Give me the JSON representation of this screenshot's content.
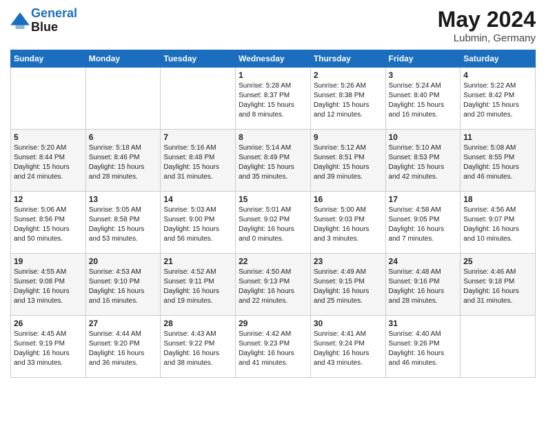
{
  "header": {
    "logo_line1": "General",
    "logo_line2": "Blue",
    "month": "May 2024",
    "location": "Lubmin, Germany"
  },
  "weekdays": [
    "Sunday",
    "Monday",
    "Tuesday",
    "Wednesday",
    "Thursday",
    "Friday",
    "Saturday"
  ],
  "weeks": [
    [
      {
        "day": "",
        "sunrise": "",
        "sunset": "",
        "daylight": ""
      },
      {
        "day": "",
        "sunrise": "",
        "sunset": "",
        "daylight": ""
      },
      {
        "day": "",
        "sunrise": "",
        "sunset": "",
        "daylight": ""
      },
      {
        "day": "1",
        "sunrise": "Sunrise: 5:28 AM",
        "sunset": "Sunset: 8:37 PM",
        "daylight": "Daylight: 15 hours and 8 minutes."
      },
      {
        "day": "2",
        "sunrise": "Sunrise: 5:26 AM",
        "sunset": "Sunset: 8:38 PM",
        "daylight": "Daylight: 15 hours and 12 minutes."
      },
      {
        "day": "3",
        "sunrise": "Sunrise: 5:24 AM",
        "sunset": "Sunset: 8:40 PM",
        "daylight": "Daylight: 15 hours and 16 minutes."
      },
      {
        "day": "4",
        "sunrise": "Sunrise: 5:22 AM",
        "sunset": "Sunset: 8:42 PM",
        "daylight": "Daylight: 15 hours and 20 minutes."
      }
    ],
    [
      {
        "day": "5",
        "sunrise": "Sunrise: 5:20 AM",
        "sunset": "Sunset: 8:44 PM",
        "daylight": "Daylight: 15 hours and 24 minutes."
      },
      {
        "day": "6",
        "sunrise": "Sunrise: 5:18 AM",
        "sunset": "Sunset: 8:46 PM",
        "daylight": "Daylight: 15 hours and 28 minutes."
      },
      {
        "day": "7",
        "sunrise": "Sunrise: 5:16 AM",
        "sunset": "Sunset: 8:48 PM",
        "daylight": "Daylight: 15 hours and 31 minutes."
      },
      {
        "day": "8",
        "sunrise": "Sunrise: 5:14 AM",
        "sunset": "Sunset: 8:49 PM",
        "daylight": "Daylight: 15 hours and 35 minutes."
      },
      {
        "day": "9",
        "sunrise": "Sunrise: 5:12 AM",
        "sunset": "Sunset: 8:51 PM",
        "daylight": "Daylight: 15 hours and 39 minutes."
      },
      {
        "day": "10",
        "sunrise": "Sunrise: 5:10 AM",
        "sunset": "Sunset: 8:53 PM",
        "daylight": "Daylight: 15 hours and 42 minutes."
      },
      {
        "day": "11",
        "sunrise": "Sunrise: 5:08 AM",
        "sunset": "Sunset: 8:55 PM",
        "daylight": "Daylight: 15 hours and 46 minutes."
      }
    ],
    [
      {
        "day": "12",
        "sunrise": "Sunrise: 5:06 AM",
        "sunset": "Sunset: 8:56 PM",
        "daylight": "Daylight: 15 hours and 50 minutes."
      },
      {
        "day": "13",
        "sunrise": "Sunrise: 5:05 AM",
        "sunset": "Sunset: 8:58 PM",
        "daylight": "Daylight: 15 hours and 53 minutes."
      },
      {
        "day": "14",
        "sunrise": "Sunrise: 5:03 AM",
        "sunset": "Sunset: 9:00 PM",
        "daylight": "Daylight: 15 hours and 56 minutes."
      },
      {
        "day": "15",
        "sunrise": "Sunrise: 5:01 AM",
        "sunset": "Sunset: 9:02 PM",
        "daylight": "Daylight: 16 hours and 0 minutes."
      },
      {
        "day": "16",
        "sunrise": "Sunrise: 5:00 AM",
        "sunset": "Sunset: 9:03 PM",
        "daylight": "Daylight: 16 hours and 3 minutes."
      },
      {
        "day": "17",
        "sunrise": "Sunrise: 4:58 AM",
        "sunset": "Sunset: 9:05 PM",
        "daylight": "Daylight: 16 hours and 7 minutes."
      },
      {
        "day": "18",
        "sunrise": "Sunrise: 4:56 AM",
        "sunset": "Sunset: 9:07 PM",
        "daylight": "Daylight: 16 hours and 10 minutes."
      }
    ],
    [
      {
        "day": "19",
        "sunrise": "Sunrise: 4:55 AM",
        "sunset": "Sunset: 9:08 PM",
        "daylight": "Daylight: 16 hours and 13 minutes."
      },
      {
        "day": "20",
        "sunrise": "Sunrise: 4:53 AM",
        "sunset": "Sunset: 9:10 PM",
        "daylight": "Daylight: 16 hours and 16 minutes."
      },
      {
        "day": "21",
        "sunrise": "Sunrise: 4:52 AM",
        "sunset": "Sunset: 9:11 PM",
        "daylight": "Daylight: 16 hours and 19 minutes."
      },
      {
        "day": "22",
        "sunrise": "Sunrise: 4:50 AM",
        "sunset": "Sunset: 9:13 PM",
        "daylight": "Daylight: 16 hours and 22 minutes."
      },
      {
        "day": "23",
        "sunrise": "Sunrise: 4:49 AM",
        "sunset": "Sunset: 9:15 PM",
        "daylight": "Daylight: 16 hours and 25 minutes."
      },
      {
        "day": "24",
        "sunrise": "Sunrise: 4:48 AM",
        "sunset": "Sunset: 9:16 PM",
        "daylight": "Daylight: 16 hours and 28 minutes."
      },
      {
        "day": "25",
        "sunrise": "Sunrise: 4:46 AM",
        "sunset": "Sunset: 9:18 PM",
        "daylight": "Daylight: 16 hours and 31 minutes."
      }
    ],
    [
      {
        "day": "26",
        "sunrise": "Sunrise: 4:45 AM",
        "sunset": "Sunset: 9:19 PM",
        "daylight": "Daylight: 16 hours and 33 minutes."
      },
      {
        "day": "27",
        "sunrise": "Sunrise: 4:44 AM",
        "sunset": "Sunset: 9:20 PM",
        "daylight": "Daylight: 16 hours and 36 minutes."
      },
      {
        "day": "28",
        "sunrise": "Sunrise: 4:43 AM",
        "sunset": "Sunset: 9:22 PM",
        "daylight": "Daylight: 16 hours and 38 minutes."
      },
      {
        "day": "29",
        "sunrise": "Sunrise: 4:42 AM",
        "sunset": "Sunset: 9:23 PM",
        "daylight": "Daylight: 16 hours and 41 minutes."
      },
      {
        "day": "30",
        "sunrise": "Sunrise: 4:41 AM",
        "sunset": "Sunset: 9:24 PM",
        "daylight": "Daylight: 16 hours and 43 minutes."
      },
      {
        "day": "31",
        "sunrise": "Sunrise: 4:40 AM",
        "sunset": "Sunset: 9:26 PM",
        "daylight": "Daylight: 16 hours and 46 minutes."
      },
      {
        "day": "",
        "sunrise": "",
        "sunset": "",
        "daylight": ""
      }
    ]
  ]
}
